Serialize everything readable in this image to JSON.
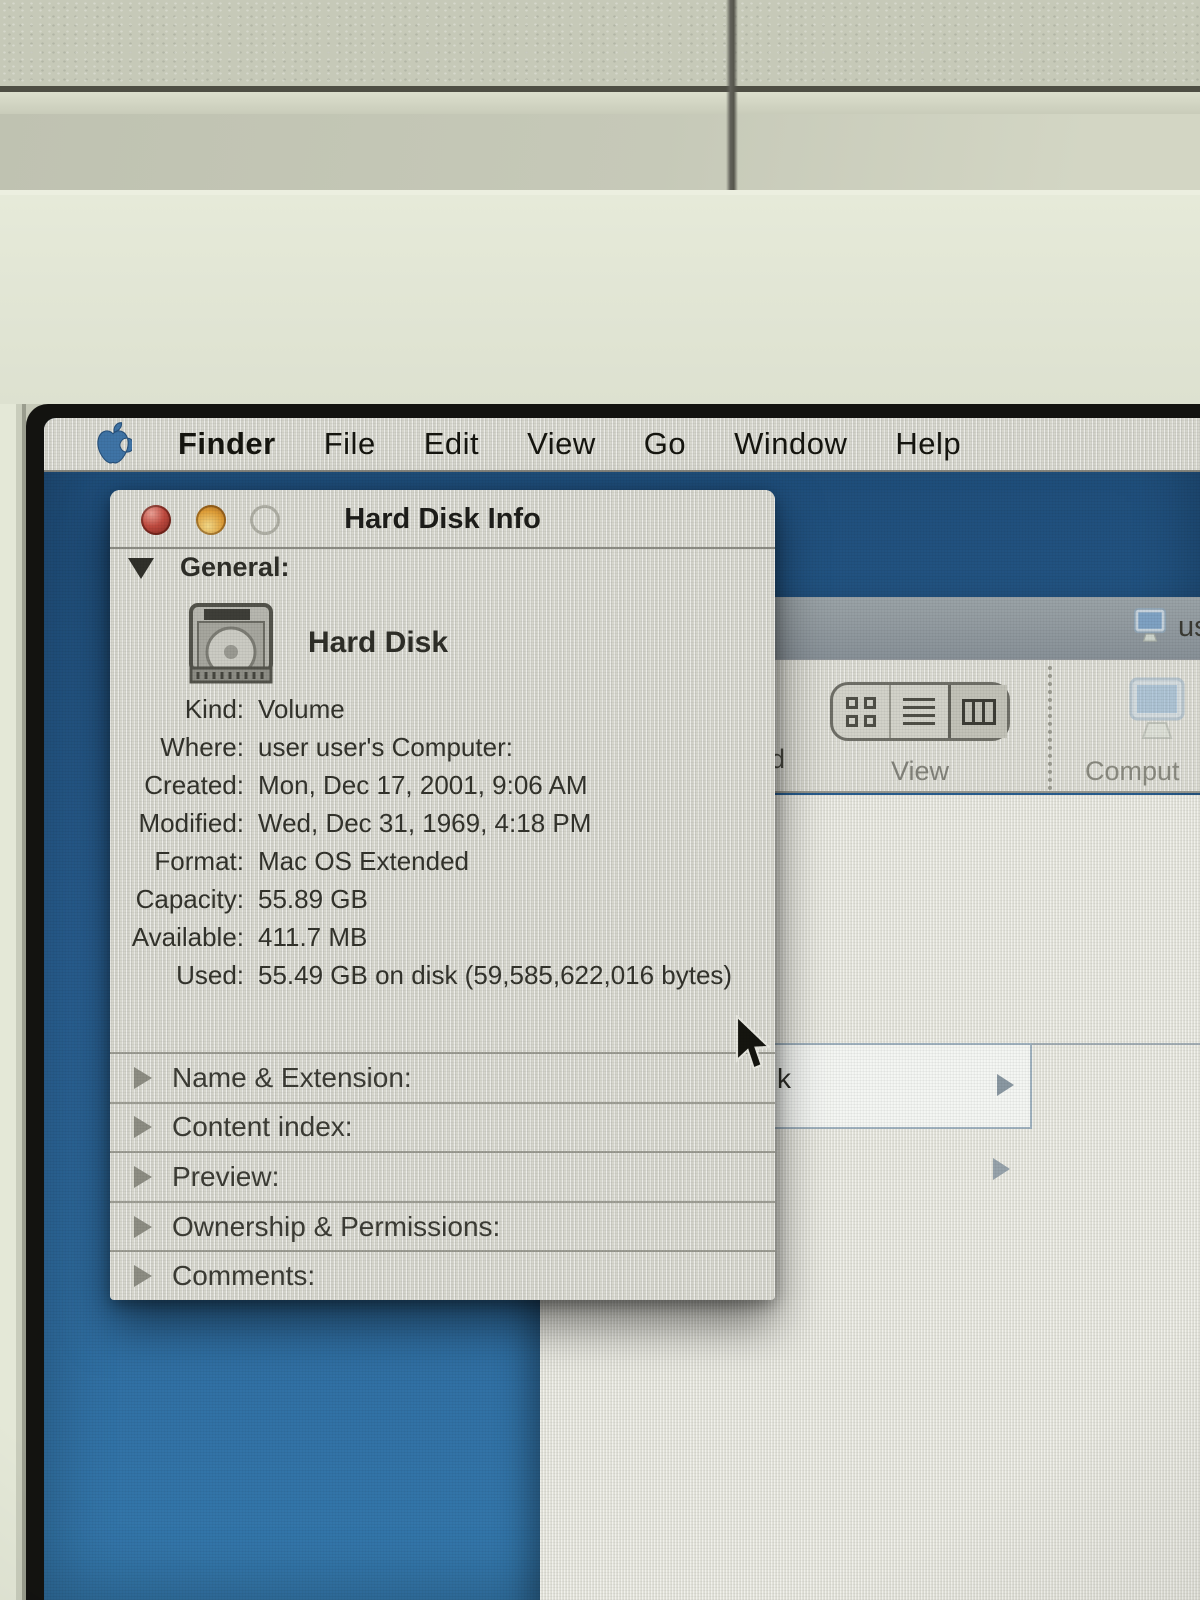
{
  "menu_bar": {
    "apple_icon": "apple-logo",
    "items": [
      "Finder",
      "File",
      "Edit",
      "View",
      "Go",
      "Window",
      "Help"
    ]
  },
  "info_window": {
    "title": "Hard Disk Info",
    "window_buttons": {
      "close": "close-button",
      "minimize": "minimize-button",
      "zoom": "zoom-button-disabled"
    },
    "general": {
      "label": "General:",
      "volume_name": "Hard Disk",
      "expanded": true
    },
    "fields": [
      {
        "label": "Kind:",
        "value": "Volume"
      },
      {
        "label": "Where:",
        "value": "user user's Computer:"
      },
      {
        "label": "Created:",
        "value": "Mon, Dec 17, 2001, 9:06 AM"
      },
      {
        "label": "Modified:",
        "value": "Wed, Dec 31, 1969, 4:18 PM"
      },
      {
        "label": "Format:",
        "value": "Mac OS Extended"
      },
      {
        "label": "Capacity:",
        "value": "55.89 GB"
      },
      {
        "label": "Available:",
        "value": "411.7 MB"
      },
      {
        "label": "Used:",
        "value": "55.49 GB on disk (59,585,622,016 bytes)"
      }
    ],
    "collapsed_sections": [
      {
        "label": "Name & Extension:"
      },
      {
        "label": "Content index:"
      },
      {
        "label": "Preview:"
      },
      {
        "label": "Ownership & Permissions:"
      },
      {
        "label": "Comments:"
      }
    ]
  },
  "background_window": {
    "title_fragment": "us",
    "toolbar": {
      "left_label_fragment": "d",
      "view_label": "View",
      "view_modes": [
        "icon-view",
        "list-view",
        "column-view-selected"
      ],
      "computer_label": "Comput"
    },
    "content": {
      "selected_item_fragment": "k"
    }
  },
  "colors": {
    "desktop_blue_top": "#1e4c78",
    "desktop_blue_bottom": "#3478ac",
    "close_red": "#bf4a3f",
    "minimize_orange": "#dd9c36",
    "window_gray": "#d6d6cd",
    "tile_wall": "#c6c9b8"
  }
}
